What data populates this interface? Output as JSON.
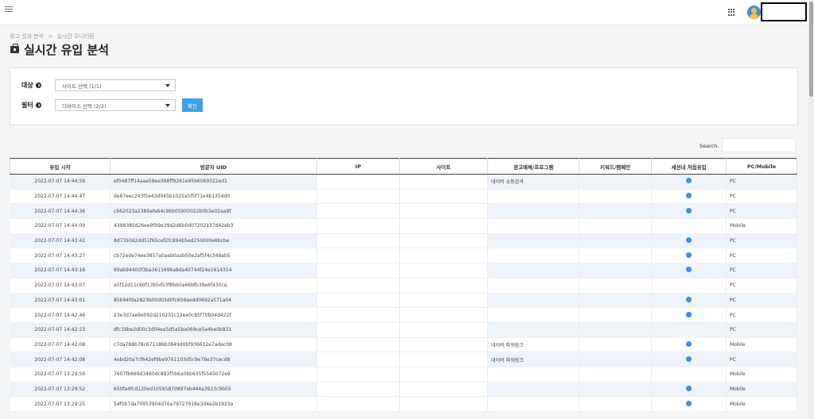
{
  "header": {
    "menu_icon": "hamburger-icon",
    "apps_icon": "grid-icon",
    "avatar_icon": "user-avatar-icon"
  },
  "breadcrumb": [
    "광고 성과 분석",
    ">",
    "실시간 모니터링"
  ],
  "page_title": "실시간 유입 분석",
  "filters": {
    "target_label": "대상",
    "target_value": "사이트 선택 (1/1)",
    "filter_label": "필터",
    "filter_value": "디바이스 선택 (2/2)",
    "confirm_label": "확인"
  },
  "search": {
    "label": "Search:",
    "value": ""
  },
  "colors": {
    "accent": "#3aa1e8",
    "row_stripe": "#eef3fa",
    "dot": "#3a8fe6"
  },
  "table": {
    "columns": [
      "유입 시각",
      "방문자 UID",
      "IP",
      "사이트",
      "광고매체/프로그램",
      "키워드/캠페인",
      "세션내 처음유입",
      "PC/Mobile"
    ],
    "rows": [
      {
        "time": "2022-07-07 14:44:59",
        "uid": "ef0487ff14aae58ee368ff9261e95b6069322ed1",
        "media": "네이버 쇼핑검색",
        "first": true,
        "device": "PC"
      },
      {
        "time": "2022-07-07 14:44:47",
        "uid": "de87eec243f5e43d045b1025a5f5f71e4b1354d0",
        "media": "",
        "first": true,
        "device": "PC"
      },
      {
        "time": "2022-07-07 14:44:36",
        "uid": "c662023a2389afe64c9bb05900022b0b3e02aa9f",
        "media": "",
        "first": true,
        "device": "PC"
      },
      {
        "time": "2022-07-07 14:44:09",
        "uid": "4398385d26ee9f09e39d2d6b0d07202137d42eb3",
        "media": "",
        "first": false,
        "device": "Mobile"
      },
      {
        "time": "2022-07-07 14:43:42",
        "uid": "8d7393d2dd51f65cef2fc894b5ed250000e6bcbe",
        "media": "",
        "first": true,
        "device": "PC"
      },
      {
        "time": "2022-07-07 14:43:27",
        "uid": "cb72ede74ee3857a0aeb0aab50e2af5f4c349ab5",
        "media": "",
        "first": true,
        "device": "PC"
      },
      {
        "time": "2022-07-07 14:43:16",
        "uid": "89ab94400f3ba3611696a8da40744f24e1614354",
        "media": "",
        "first": true,
        "device": "PC"
      },
      {
        "time": "2022-07-07 14:43:07",
        "uid": "a5f12d11c60f13b5d53f8b60a66bfb39e6f430ce",
        "media": "",
        "first": false,
        "device": "PC"
      },
      {
        "time": "2022-07-07 14:43:01",
        "uid": "85b94fda2823b00d03d0fc656eedd0692a571a04",
        "media": "",
        "first": true,
        "device": "PC"
      },
      {
        "time": "2022-07-07 14:42:46",
        "uid": "23e3d7ae9e092d210231c12ee0c85f70b04d422f",
        "media": "",
        "first": true,
        "device": "PC"
      },
      {
        "time": "2022-07-07 14:42:23",
        "uid": "dfc19be2d00c3d04ea5d5a5ba069ce5a4be0b831",
        "media": "",
        "first": false,
        "device": "PC"
      },
      {
        "time": "2022-07-07 14:42:08",
        "uid": "c7da788b78c671186b3849d0bf936612e7adec08",
        "media": "네이버 파워링크",
        "first": true,
        "device": "Mobile"
      },
      {
        "time": "2022-07-07 14:42:08",
        "uid": "4ebd20a7cf642ef9be9761103d5c9e78e37cecd8",
        "media": "네이버 파워링크",
        "first": true,
        "device": "PC"
      },
      {
        "time": "2022-07-07 13:29:59",
        "uid": "7607fb669d3460dc893f5b6a0bb635f5545072e9",
        "media": "",
        "first": false,
        "device": "Mobile"
      },
      {
        "time": "2022-07-07 13:29:52",
        "uid": "650fa4fcd120ed10595870897eb444a3923c9b55",
        "media": "",
        "first": true,
        "device": "Mobile"
      },
      {
        "time": "2022-07-07 13:29:25",
        "uid": "54f5b7da70953904d76a79727918e3d4e2b1923a",
        "media": "",
        "first": true,
        "device": "Mobile"
      }
    ]
  }
}
